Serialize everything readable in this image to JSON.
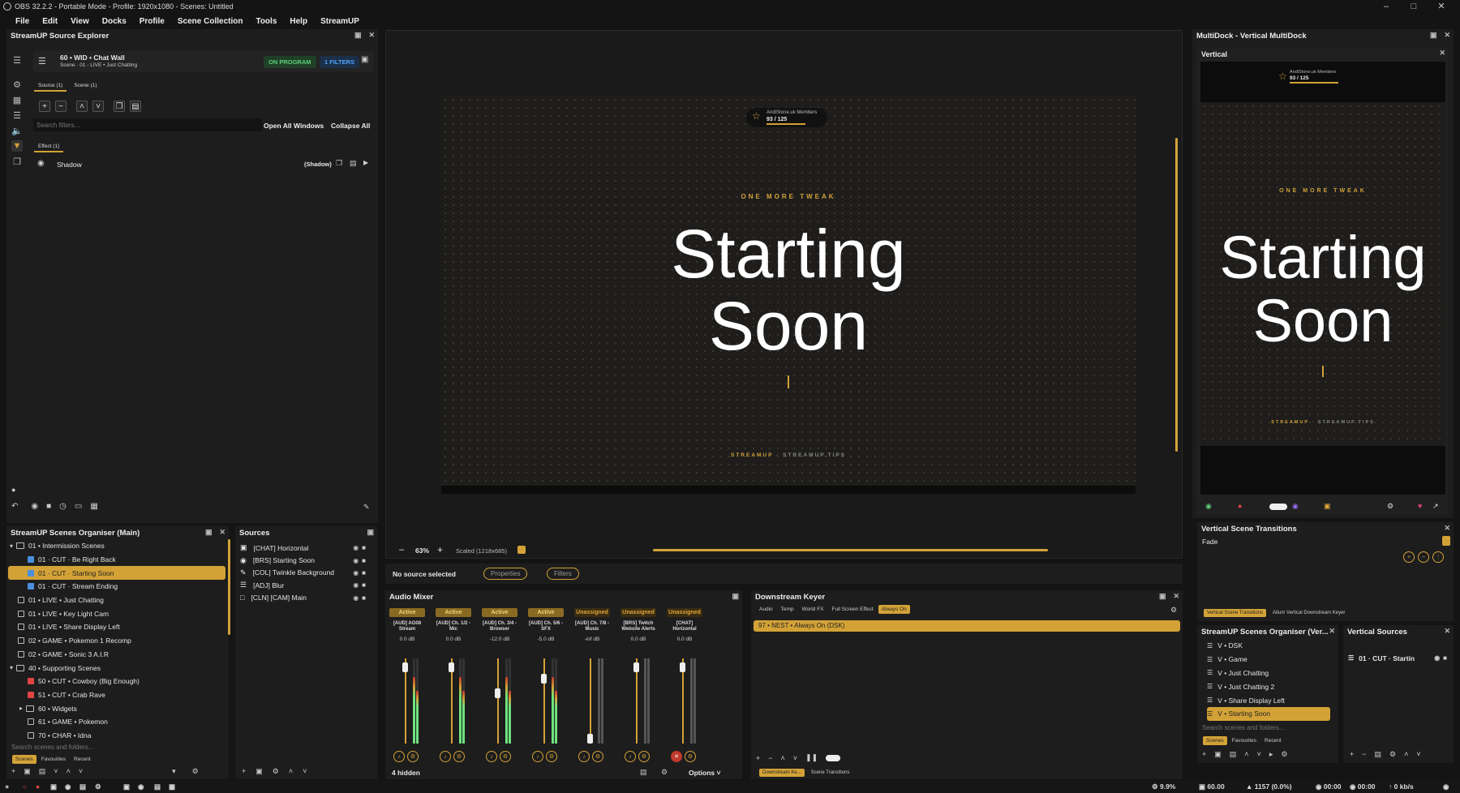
{
  "window": {
    "title": "OBS 32.2.2 - Portable Mode - Profile: 1920x1080 - Scenes: Untitled"
  },
  "menu": [
    "File",
    "Edit",
    "View",
    "Docks",
    "Profile",
    "Scene Collection",
    "Tools",
    "Help",
    "StreamUP"
  ],
  "explorer": {
    "title": "StreamUP Source Explorer",
    "source_name": "60 • WID • Chat Wall",
    "source_scene": "Scene · 01 - LIVE • Just Chatting",
    "on_program": "ON PROGRAM",
    "filters_count": "1 FILTERS",
    "tab_source": "Source (1)",
    "tab_scene": "Scene (1)",
    "search_placeholder": "Search filters...",
    "open_all": "Open All Windows",
    "collapse_all": "Collapse All",
    "effect_tab": "Effect (1)",
    "filter_name": "Shadow",
    "filter_type": "(Shadow)"
  },
  "preview": {
    "widget_title": "AndiStone.uk Members",
    "widget_count": "93 / 125",
    "tagline": "ONE MORE TWEAK",
    "line1": "Starting",
    "line2": "Soon",
    "footer_brand": "STREAMUP",
    "footer_site": "· STREAMUP.TIPS",
    "zoom": "63%",
    "scaled": "Scaled (1218x685)"
  },
  "context": {
    "no_source": "No source selected",
    "properties": "Properties",
    "filters": "Filters"
  },
  "multidock": {
    "title": "MultiDock - Vertical MultiDock",
    "vertical_title": "Vertical"
  },
  "scenes": {
    "title": "StreamUP Scenes Organiser (Main)",
    "search_placeholder": "Search scenes and folders...",
    "tabs": [
      "Scenes",
      "Favourites",
      "Recent"
    ],
    "rows": [
      {
        "label": "01 • Intermission Scenes",
        "type": "folder",
        "indent": 0
      },
      {
        "label": "01 · CUT · Be Right Back",
        "type": "blue",
        "indent": 1
      },
      {
        "label": "01 · CUT · Starting Soon",
        "type": "blue",
        "indent": 1,
        "selected": true
      },
      {
        "label": "01 · CUT · Stream Ending",
        "type": "blue",
        "indent": 1
      },
      {
        "label": "01 • LIVE • Just Chatting",
        "type": "cam",
        "indent": 0
      },
      {
        "label": "01 • LIVE • Key Light Cam",
        "type": "cam",
        "indent": 0
      },
      {
        "label": "01 • LIVE • Share Display Left",
        "type": "display",
        "indent": 0
      },
      {
        "label": "02 • GAME • Pokemon 1 Recomp",
        "type": "game",
        "indent": 0
      },
      {
        "label": "02 • GAME • Sonic 3 A.I.R",
        "type": "game",
        "indent": 0
      },
      {
        "label": "40 • Supporting Scenes",
        "type": "folder",
        "indent": 0
      },
      {
        "label": "50 • CUT • Cowboy (Big Enough)",
        "type": "red",
        "indent": 1
      },
      {
        "label": "51 • CUT • Crab Rave",
        "type": "red",
        "indent": 1
      },
      {
        "label": "60 • Widgets",
        "type": "folder",
        "indent": 1
      },
      {
        "label": "61 • GAME • Pokemon",
        "type": "game",
        "indent": 1
      },
      {
        "label": "70 • CHAR • Idna",
        "type": "game",
        "indent": 1
      }
    ]
  },
  "sources": {
    "title": "Sources",
    "rows": [
      "[CHAT] Horizontal",
      "[BRS] Starting Soon",
      "[COL] Twinkle Background",
      "[ADJ] Blur",
      "[CLN] [CAM] Main"
    ]
  },
  "mixer": {
    "title": "Audio Mixer",
    "hidden": "4 hidden",
    "options": "Options",
    "channels": [
      {
        "status": "Active",
        "name": "[AUD] AG08 Stream",
        "db": "0.0 dB",
        "level": 0.95,
        "muted": false
      },
      {
        "status": "Active",
        "name": "[AUD] Ch. 1/2 - Mic",
        "db": "0.0 dB",
        "level": 0.95,
        "muted": false
      },
      {
        "status": "Active",
        "name": "[AUD] Ch. 3/4 - Browser",
        "db": "-12.0 dB",
        "level": 0.6,
        "muted": false
      },
      {
        "status": "Active",
        "name": "[AUD] Ch. 5/6 - SFX",
        "db": "-5.0 dB",
        "level": 0.8,
        "muted": false
      },
      {
        "status": "Unassigned",
        "name": "[AUD] Ch. 7/8 - Music",
        "db": "-inf dB",
        "level": 0.0,
        "muted": false
      },
      {
        "status": "Unassigned",
        "name": "[BRS] Twitch Website Alerts",
        "db": "0.0 dB",
        "level": 0.95,
        "muted": false
      },
      {
        "status": "Unassigned",
        "name": "[CHAT] Horizontal",
        "db": "0.0 dB",
        "level": 0.95,
        "muted": true
      }
    ]
  },
  "dsk": {
    "title": "Downstream Keyer",
    "tabs": [
      "Audio",
      "Temp",
      "World FX",
      "Full Screen Effect",
      "Always On"
    ],
    "item": "97 • NEST • Always On (DSK)",
    "bottom_tabs": [
      "Downstream Ke...",
      "Scene Transitions"
    ]
  },
  "vtrans": {
    "title": "Vertical Scene Transitions",
    "value": "Fade",
    "bottom_tabs": [
      "Vertical Scene Transitions",
      "Aitum Vertical Downstream Keyer"
    ]
  },
  "vscenes": {
    "title": "StreamUP Scenes Organiser (Ver...",
    "rows": [
      "V • DSK",
      "V • Game",
      "V • Just Chatting",
      "V • Just Chatting 2",
      "V • Share Display Left",
      "V • Starting Soon"
    ],
    "search_placeholder": "Search scenes and folders...",
    "tabs": [
      "Scenes",
      "Favourites",
      "Recent"
    ]
  },
  "vsources": {
    "title": "Vertical Sources",
    "row": "01 · CUT · Startin"
  },
  "status": {
    "cpu": "9.9%",
    "fps": "60.00",
    "dropped": "1157 (0.0%)",
    "rec_time": "00:00",
    "stream_time": "00:00",
    "kbps": "0 kb/s"
  },
  "colors": {
    "accent": "#d3a237",
    "bg": "#1d1d1d",
    "active_green": "#5fd07a",
    "filter_blue": "#4fa3ff"
  }
}
